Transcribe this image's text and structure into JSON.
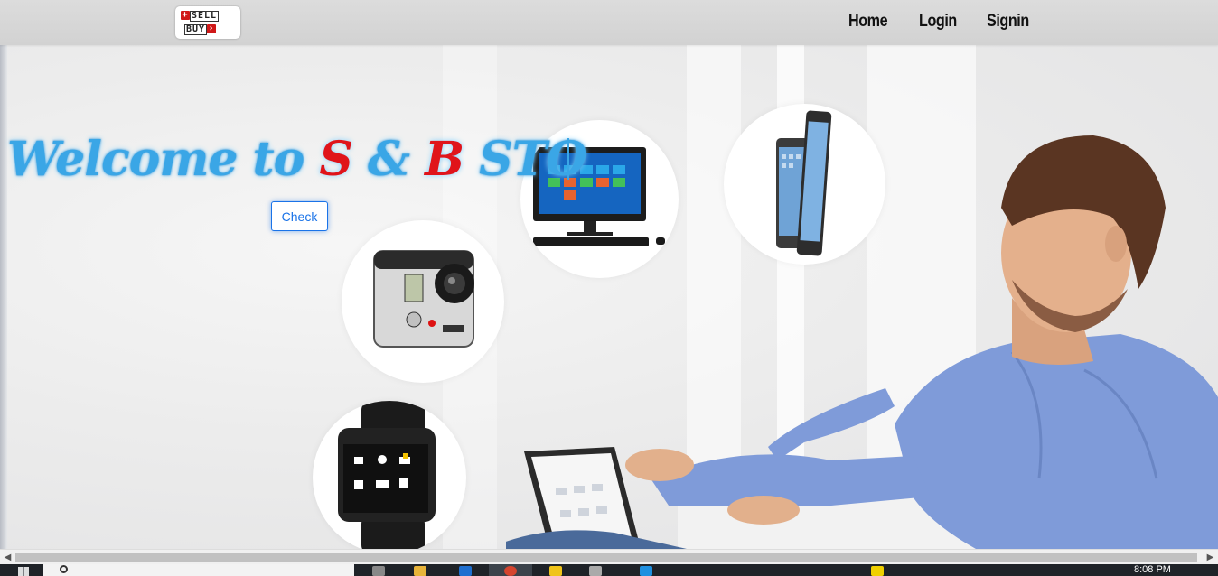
{
  "logo": {
    "line1": "SELL",
    "line2": "BUY"
  },
  "nav": {
    "home": "Home",
    "login": "Login",
    "signin": "Signin"
  },
  "hero": {
    "headline_prefix": "Welcome to ",
    "headline_s": "S",
    "headline_amp": " & ",
    "headline_b": "B",
    "headline_suffix": " STO",
    "check_label": "Check"
  },
  "products": [
    "monitor",
    "smartphone",
    "action-camera",
    "smartwatch"
  ],
  "taskbar": {
    "clock": "8:08 PM"
  },
  "colors": {
    "headline": "#3aa6e6",
    "headline_accent": "#e0141a",
    "button_border": "#1a73e8",
    "navbar": "#d6d6d6"
  }
}
